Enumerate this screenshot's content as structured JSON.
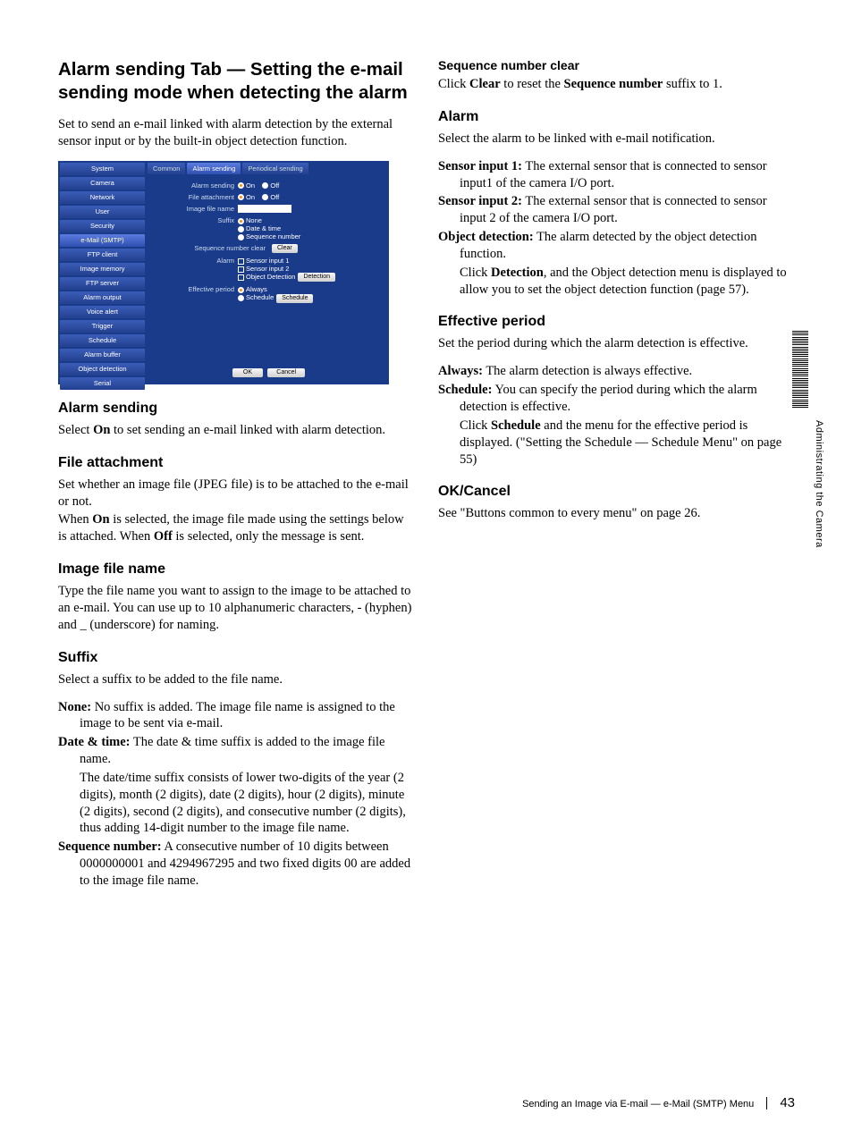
{
  "left": {
    "main_title": "Alarm sending Tab — Setting the e-mail sending mode when detecting the alarm",
    "intro": "Set to send an e-mail linked with alarm detection by the external sensor input or by the built-in object detection function.",
    "h_alarm_sending": "Alarm sending",
    "p_alarm_sending": "Select On to set sending an e-mail linked with alarm detection.",
    "h_file_attachment": "File attachment",
    "p_file_attachment_1": "Set whether an image file (JPEG file) is to be attached to the e-mail or not.",
    "p_file_attachment_2": "When On is selected, the image file made using the settings below is attached. When Off is selected, only the message is sent.",
    "h_image_file_name": "Image file name",
    "p_image_file_name": "Type the file name you want to assign to the image to be attached to an e-mail. You can use up to 10 alphanumeric characters, - (hyphen) and _ (underscore) for naming.",
    "h_suffix": "Suffix",
    "p_suffix_intro": "Select a suffix to be added to the file name.",
    "suffix_none_term": "None:",
    "suffix_none_text": " No suffix is added. The image file name is assigned to the image to be sent via e-mail.",
    "suffix_dt_term": "Date & time:",
    "suffix_dt_text": " The date & time suffix is added to the image file name.",
    "suffix_dt_cont": "The date/time suffix consists of lower two-digits of the year (2 digits), month (2 digits), date (2 digits), hour (2 digits), minute (2 digits), second (2 digits), and consecutive number (2 digits), thus adding 14-digit number to the image file name.",
    "suffix_seq_term": "Sequence number:",
    "suffix_seq_text": " A consecutive number of 10 digits between 0000000001 and 4294967295 and two fixed digits 00 are added to the image file name."
  },
  "right": {
    "h_seq_clear": "Sequence number clear",
    "p_seq_clear_pre": "Click ",
    "p_seq_clear_bold1": "Clear",
    "p_seq_clear_mid": " to reset the ",
    "p_seq_clear_bold2": "Sequence number",
    "p_seq_clear_post": " suffix to 1.",
    "h_alarm": "Alarm",
    "p_alarm_intro": "Select the alarm to be linked with e-mail notification.",
    "sensor1_term": "Sensor input 1:",
    "sensor1_text": " The external sensor that is connected to sensor input1 of the camera I/O port.",
    "sensor2_term": "Sensor input 2:",
    "sensor2_text": " The external sensor that is connected to sensor input 2 of the camera I/O port.",
    "objdet_term": "Object detection:",
    "objdet_text": " The alarm detected by the object detection function.",
    "objdet_cont_pre": "Click ",
    "objdet_cont_bold": "Detection",
    "objdet_cont_post": ", and the Object detection menu is displayed to allow you to set the object detection function (page 57).",
    "h_effective": "Effective period",
    "p_effective_intro": "Set the period during which the alarm detection is effective.",
    "always_term": "Always:",
    "always_text": " The alarm detection is always effective.",
    "schedule_term": "Schedule:",
    "schedule_text": " You can specify the period during which the alarm detection is effective.",
    "schedule_cont_pre": "Click ",
    "schedule_cont_bold": "Schedule",
    "schedule_cont_post": " and the menu for the effective period is displayed. (\"Setting the Schedule — Schedule Menu\" on page 55)",
    "h_okcancel": "OK/Cancel",
    "p_okcancel": "See \"Buttons common to every menu\" on page 26."
  },
  "screenshot": {
    "sidebar": [
      "System",
      "Camera",
      "Network",
      "User",
      "Security",
      "e-Mail (SMTP)",
      "FTP client",
      "Image memory",
      "FTP server",
      "Alarm output",
      "Voice alert",
      "Trigger",
      "Schedule",
      "Alarm buffer",
      "Object detection",
      "Serial"
    ],
    "sidebar_active_index": 5,
    "tabs": [
      "Common",
      "Alarm sending",
      "Periodical sending"
    ],
    "tab_active_index": 1,
    "rows": {
      "alarm_sending_label": "Alarm sending",
      "on": "On",
      "off": "Off",
      "file_attachment_label": "File attachment",
      "image_file_name_label": "Image file name",
      "suffix_label": "Suffix",
      "suffix_none": "None",
      "suffix_dt": "Date & time",
      "suffix_seq": "Sequence number",
      "seq_clear_label": "Sequence number clear",
      "clear_btn": "Clear",
      "alarm_label": "Alarm",
      "sensor1": "Sensor input 1",
      "sensor2": "Sensor input 2",
      "objdet": "Object Detection",
      "detection_btn": "Detection",
      "effective_label": "Effective period",
      "always": "Always",
      "schedule": "Schedule",
      "schedule_btn": "Schedule",
      "ok_btn": "OK",
      "cancel_btn": "Cancel"
    }
  },
  "side_label": "Administrating the Camera",
  "footer": {
    "text": "Sending an Image via E-mail — e-Mail (SMTP) Menu",
    "page": "43"
  }
}
